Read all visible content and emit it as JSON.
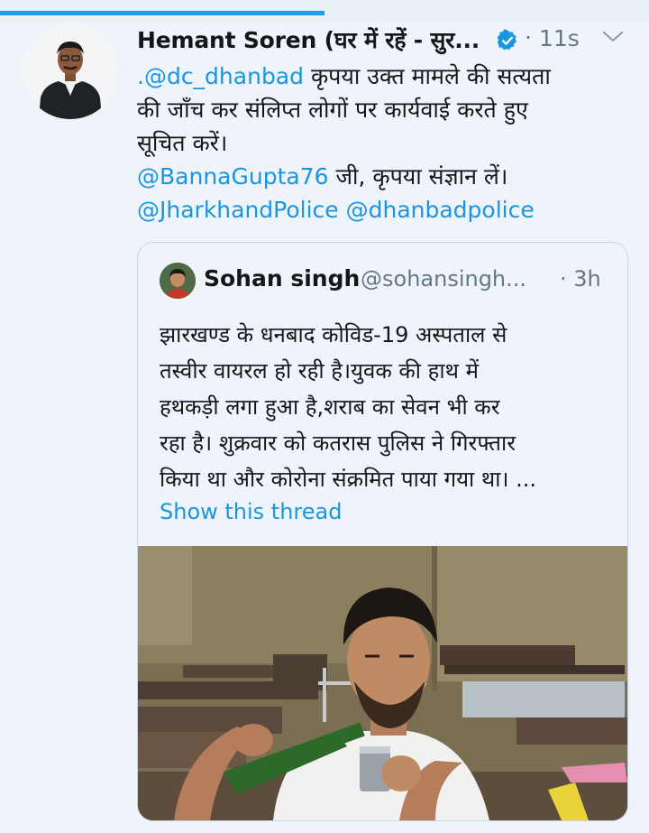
{
  "tweet": {
    "author_name": "Hemant Soren (घर में रहें - सुर...",
    "timestamp": "11s",
    "dot": "·",
    "lines": [
      {
        "mention": ".@dc_dhanbad",
        "text": " कृपया उक्त मामले की सत्यता"
      },
      {
        "mention": "",
        "text": "की जाँच कर संलिप्त लोगों पर कार्यवाई करते हुए"
      },
      {
        "mention": "",
        "text": "सूचित करें।"
      },
      {
        "mention": "@BannaGupta76",
        "text": " जी, कृपया संज्ञान लें।"
      },
      {
        "mention": "@JharkhandPolice @dhanbadpolice",
        "text": ""
      }
    ]
  },
  "quoted_tweet": {
    "author_name": "Sohan singh",
    "handle": "@sohansingh...",
    "timestamp": "· 3h",
    "lines": [
      "झारखण्ड के धनबाद कोविड-19 अस्पताल से",
      "तस्वीर वायरल हो रही है।युवक की हाथ में",
      "हथकड़ी लगा हुआ है,शराब का सेवन भी कर",
      "रहा है। शुक्रवार को कतरास पुलिस ने गिरफ्तार",
      "किया था और कोरोना संक्रमित पाया गया था। ..."
    ],
    "show_thread": "Show this thread"
  },
  "colors": {
    "background": "#eef4fa",
    "accent": "#1b95e0",
    "progress": "#1f9bf0",
    "secondary_text": "#657786"
  },
  "icons": {
    "verified": "verified-badge-icon",
    "caret": "chevron-down-icon"
  },
  "progress": {
    "fraction": 0.5
  }
}
